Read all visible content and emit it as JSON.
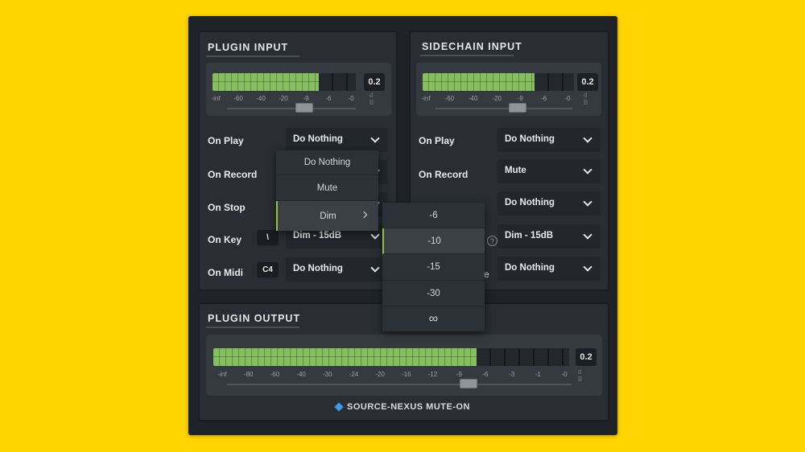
{
  "plugin_input": {
    "title": "PLUGIN INPUT",
    "meter": {
      "level_fraction": 0.74,
      "value": "0.2",
      "unit": "dB",
      "scale": [
        "-inf",
        "-60",
        "-40",
        "-20",
        "-9",
        "-6",
        "-0"
      ],
      "gain_slider_fraction": 0.6
    },
    "rows": [
      {
        "label": "On Play",
        "value": "Do Nothing",
        "key": ""
      },
      {
        "label": "On Record",
        "value": "",
        "key": ""
      },
      {
        "label": "On Stop",
        "value": "",
        "key": ""
      },
      {
        "label": "On Key",
        "value": "Dim - 15dB",
        "key": "\\"
      },
      {
        "label": "On Midi",
        "value": "Do Nothing",
        "key": "C4"
      }
    ]
  },
  "sidechain_input": {
    "title": "SIDECHAIN INPUT",
    "meter": {
      "level_fraction": 0.74,
      "value": "0.2",
      "unit": "dB",
      "scale": [
        "-inf",
        "-60",
        "-40",
        "-20",
        "-9",
        "-6",
        "-0"
      ],
      "gain_slider_fraction": 0.6
    },
    "rows": [
      {
        "label": "On Play",
        "value": "Do Nothing"
      },
      {
        "label": "On Record",
        "value": "Mute"
      },
      {
        "label": "On Stop",
        "value": "Do Nothing"
      },
      {
        "label": "",
        "value": "Dim - 15dB"
      },
      {
        "label": "",
        "value": "Do Nothing"
      }
    ],
    "partial_text": "e"
  },
  "plugin_output": {
    "title": "PLUGIN OUTPUT",
    "meter": {
      "level_fraction": 0.74,
      "value": "0.2",
      "unit": "dB",
      "scale": [
        "-inf",
        "-80",
        "-60",
        "-40",
        "-30",
        "-24",
        "-20",
        "-16",
        "-12",
        "-9",
        "-6",
        "-3",
        "-1",
        "-0"
      ],
      "gain_slider_fraction": 0.7
    }
  },
  "context_menu": {
    "items": [
      "Do Nothing",
      "Mute",
      "Dim"
    ],
    "active": "Dim"
  },
  "submenu": {
    "items": [
      "-6",
      "-10",
      "-15",
      "-30",
      "∞"
    ],
    "active": "-10"
  },
  "footer": {
    "text": "SOURCE-NEXUS MUTE-ON"
  },
  "colors": {
    "background": "#ffd400",
    "meter_green": "#86bf5f",
    "accent_blue": "#3d9be9",
    "active_marker": "#8cc63f"
  }
}
